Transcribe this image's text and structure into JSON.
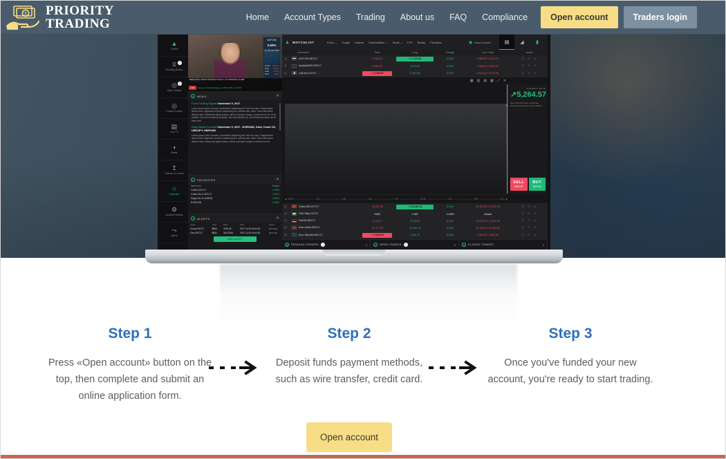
{
  "brand": {
    "line1": "PRIORITY",
    "line2": "TRADING",
    "logo_icon": "money-in-hand-icon",
    "accent_yellow": "#f7dd86",
    "header_bg": "#4a5c6b",
    "step_heading_color": "#2f70b8",
    "footer_rule_color": "#c5694f"
  },
  "nav": {
    "links": [
      {
        "label": "Home"
      },
      {
        "label": "Account Types"
      },
      {
        "label": "Trading"
      },
      {
        "label": "About us"
      },
      {
        "label": "FAQ"
      },
      {
        "label": "Compliance"
      }
    ],
    "open_account": "Open account",
    "traders_login": "Traders login"
  },
  "platform": {
    "rail": [
      {
        "label": "Trades",
        "icon": "chart-icon",
        "active": true,
        "badge": ""
      },
      {
        "label": "Pending Orders",
        "icon": "hourglass-icon",
        "active": false,
        "badge": "1"
      },
      {
        "label": "Open Trades",
        "icon": "target-icon",
        "active": false,
        "badge": "2"
      },
      {
        "label": "Closed Trades",
        "icon": "target-check-icon",
        "active": false,
        "badge": ""
      },
      {
        "label": "Live TV",
        "icon": "tv-icon",
        "active": false,
        "badge": ""
      },
      {
        "label": "News",
        "icon": "megaphone-icon",
        "active": false,
        "badge": ""
      },
      {
        "label": "Gainers & Losers",
        "icon": "arrows-icon",
        "active": false,
        "badge": ""
      },
      {
        "label": "Favorites",
        "icon": "star-icon",
        "active": true,
        "badge": ""
      },
      {
        "label": "Account Details",
        "icon": "gear-icon",
        "active": false,
        "badge": ""
      },
      {
        "label": "Alerts",
        "icon": "bell-icon",
        "active": false,
        "badge": ""
      }
    ],
    "tv": {
      "live_badge": "LIVE",
      "quote_name": "S&P 500",
      "quote_change": "2.62%",
      "quote_sub": "12:48 am  Dec 7up",
      "headline": "BREAKING NEWS  MARKETS RALLY AS INDEXES CLIMB",
      "ticker_tag": "LIVE",
      "ticker_text": "Dow ▲ 0.41%   Nasdaq ▲ 0.24%   S&P ▲ 0.31%",
      "rows": [
        {
          "sym": "DOW",
          "val": "-118.20"
        },
        {
          "sym": "NAS",
          "val": "-41.60"
        },
        {
          "sym": "S&P",
          "val": "-13.40"
        },
        {
          "sym": "RUT",
          "val": "-6.20"
        }
      ]
    },
    "news": {
      "panel_title": "NEWS",
      "close": "✕",
      "items": [
        {
          "title": "Forex Trading Signals",
          "date": "November 9, 2017",
          "body": "Lorem ipsum dolor sit amet, consectetur adipiscing elit. Sed nec risus. Suspendisse lectus tortor, dignissim sit amet, adipiscing nec, ultricies sed, dolor. Cras elementum ultrices diam. Maecenas ligula massa, varius a semper congue, euismod non mi. Proin porttitor, orci nec nonummy molestie, enim est eleifend mi, non fermentum diam nisl sit amet erat."
        },
        {
          "title": "Daily Market Forecast",
          "date": "November 9, 2017 - EUR/USD, Gold, Crude Oil, USD/JPY, GBP/USD",
          "body": "Lorem ipsum dolor sit amet, consectetur adipiscing elit. Sed nec risus. Suspendisse lectus tortor, dignissim sit amet, adipiscing nec, ultricies sed, dolor. Cras elementum ultrices diam. Maecenas ligula massa, varius a semper congue, euismod non mi."
        }
      ]
    },
    "favorites": {
      "panel_title": "FAVORITES",
      "close": "✕",
      "columns": [
        "Instrument",
        "Change"
      ],
      "rows": [
        {
          "instrument": "Coffee-DEC17",
          "change": "0.58%"
        },
        {
          "instrument": "Cotton No.2-DEC17",
          "change": "0.92%"
        },
        {
          "instrument": "Sugar No.11-MAR18",
          "change": "0.62%"
        },
        {
          "instrument": "EUR/USD",
          "change": "0.28%"
        }
      ]
    },
    "alerts": {
      "panel_title": "ALERTS",
      "close": "✕",
      "columns": [
        "Asset",
        "Type",
        "Rate",
        "Date",
        "Action"
      ],
      "rows": [
        {
          "asset": "Cocoa-DEC17",
          "type": "SELL",
          "rate": "2196.39",
          "date": "2017-11-09 16:40:15",
          "action": "EDIT   DEL"
        },
        {
          "asset": "Corn-DEC17",
          "type": "SELL",
          "rate": "344.33/45",
          "date": "2017-11-09 16:40:30",
          "action": "EDIT   DEL"
        }
      ],
      "add_button": "ADD ALERT"
    },
    "watchlist": {
      "title": "WATCHLIST",
      "title_icon": "mountain-chart-icon",
      "menu": [
        "Forex ⌄",
        "Crypto",
        "Indices",
        "Commodities ⌄",
        "Stock ⌄",
        "ETF",
        "Bonds",
        "Favorites"
      ],
      "search_icon": "search-icon",
      "search_placeholder": "Search asset ...",
      "tools": [
        "grid-view-icon",
        "chart-view-icon",
        "list-view-icon"
      ],
      "columns": [
        "Instrument",
        "Short",
        "Long",
        "Change",
        "Low / High",
        "Action"
      ],
      "rows": [
        {
          "flag": "#ae1c28,#ffffff,#21468b",
          "instrument": "AUS 200-DEC17",
          "caret": "",
          "short": "6 028.34",
          "short_style": "red",
          "long": "↗ 6 028.99",
          "long_style": "pill-green",
          "change": "0.23%",
          "change_style": "green",
          "lowhigh": "5 986.50 / 6 049.75",
          "action": "info-trade-star"
        },
        {
          "flag": "#00247d,#ffffff,#cf142b",
          "instrument": "Australia200-DEC17",
          "caret": "",
          "short": "5 666.16",
          "short_style": "red",
          "long": "5 673.04",
          "long_style": "green",
          "change": "0.29%",
          "change_style": "green",
          "lowhigh": "5 658.00 / 5 691.00",
          "action": "info-trade-star"
        },
        {
          "flag": "#002395,#ffffff,#ed2939",
          "instrument": "CACAO-OCT17",
          "caret": "⌄",
          "short": "↘ 5 240.87",
          "short_style": "pill-red",
          "long": "5 161.88",
          "long_style": "green",
          "change": "0.07%",
          "change_style": "green",
          "lowhigh": "5 013.50 / 5 273.50",
          "action": "info-trade-star"
        }
      ],
      "lower_rows": [
        {
          "flag": "#de2910,#ffde00,#de2910",
          "instrument": "China A50-OCT17",
          "caret": "",
          "short": "13 032.90",
          "short_style": "red",
          "long": "↗ 13 046.13",
          "long_style": "pill-green",
          "change": "0.15%",
          "change_style": "green",
          "lowhigh": "12 952.00 / 13 047.00",
          "action": "info-trade-star"
        },
        {
          "flag": "#ff9933,#ffffff,#138808",
          "instrument": "CNX Nifty-OCT17",
          "caret": "",
          "short": "9 687",
          "short_style": "white",
          "long": "9 687",
          "long_style": "white",
          "change": "-0.35%",
          "change_style": "white",
          "lowhigh": "Closed",
          "action": "info-trade-star"
        },
        {
          "flag": "#000000,#dd0000,#ffce00",
          "instrument": "DAX30-DEC17",
          "caret": "",
          "short": "13 291.2",
          "short_style": "red",
          "long": "13 103.8",
          "long_style": "green",
          "change": "0.14%",
          "change_style": "green",
          "lowhigh": "13 043.50 / 13 621.00",
          "action": "info-trade-star"
        },
        {
          "flag": "#3c3b6e,#ffffff,#b22234",
          "instrument": "Dow Jones-DEC17",
          "caret": "",
          "short": "23 377.06",
          "short_style": "red",
          "long": "23 302.18",
          "long_style": "green",
          "change": "0.03%",
          "change_style": "green",
          "lowhigh": "23 129.44 / 23 394.00",
          "action": "info-trade-star"
        },
        {
          "flag": "#003399,#ffcc00,#003399",
          "instrument": "Euro Stoxx50-DEC17",
          "caret": "",
          "short": "↘ 3 626.26",
          "short_style": "pill-red",
          "long": "3 610.74",
          "long_style": "green",
          "change": "0.04%",
          "change_style": "green",
          "lowhigh": "3 594.00 / 3 639.00",
          "action": "info-trade-star"
        }
      ]
    },
    "chart": {
      "tools": [
        "bar-chart-icon",
        "line-chart-icon",
        "candle-chart-icon",
        "indicator-icon",
        "fullscreen-icon",
        "close-icon"
      ],
      "time_labels": [
        "19:00",
        "1:00",
        "0:00",
        "0:30",
        "1:00",
        "18:30",
        "4:00",
        "4:30",
        "5:00"
      ],
      "rate_label": "CURRENT RATE",
      "rate_value": "5,264.57",
      "rate_prefix": "↗",
      "rate_desc": "Euro  CACAO  Index, Sentiment Procurement Finance  Price (EUR)",
      "sell_label": "SELL",
      "sell_price": "5261.87",
      "buy_label": "BUY",
      "buy_price": "5267.83"
    },
    "bottom_tabs": [
      {
        "label": "PENDING ORDERS",
        "count": "1",
        "close": "x"
      },
      {
        "label": "OPEN TRADES",
        "count": "2",
        "close": "x"
      },
      {
        "label": "CLOSED TRADES",
        "count": "",
        "close": "x"
      }
    ]
  },
  "steps": {
    "items": [
      {
        "heading": "Step 1",
        "text": "Press «Open account» button on the top, then complete and submit an online application form."
      },
      {
        "heading": "Step 2",
        "text": "Deposit funds payment methods, such as wire transfer, credit card."
      },
      {
        "heading": "Step 3",
        "text": "Once you've funded your new account, you're ready to start trading."
      }
    ],
    "arrow_icon": "dashed-arrow-right-icon",
    "cta_label": "Open account"
  }
}
